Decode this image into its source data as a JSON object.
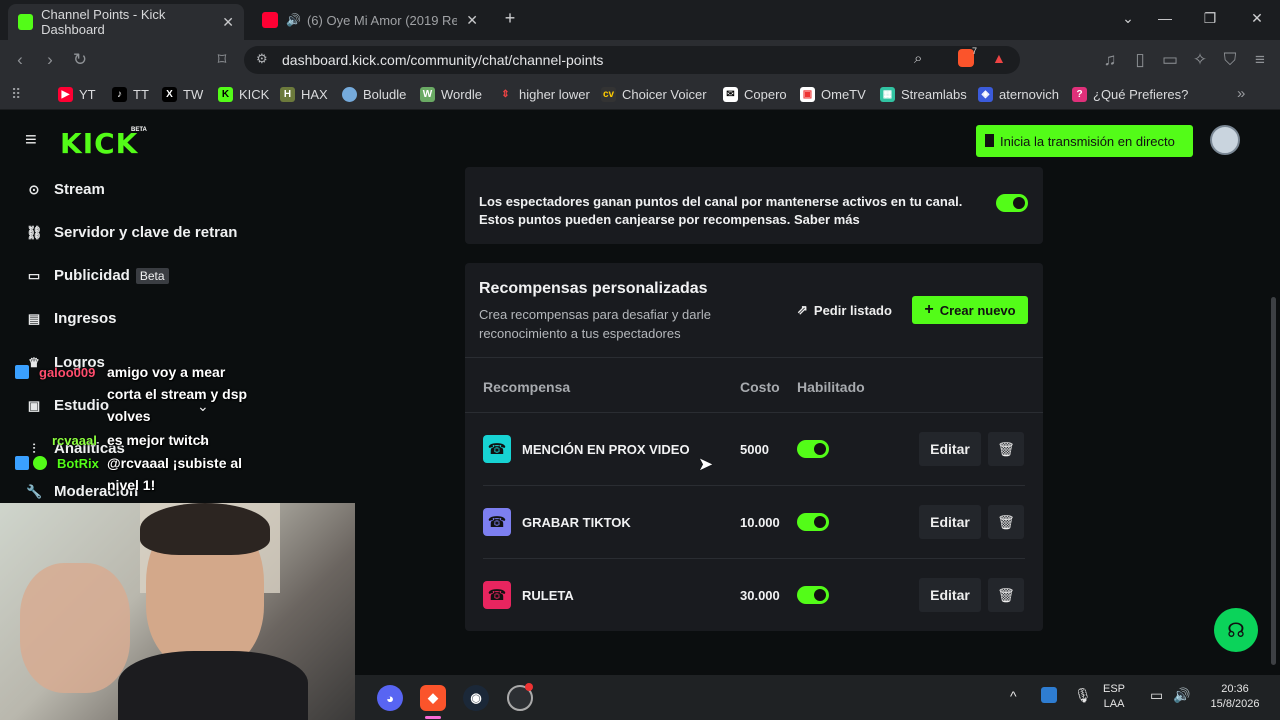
{
  "browser": {
    "tabs": [
      {
        "title": "Channel Points - Kick Dashboard",
        "close": "✕"
      },
      {
        "title": "(6) Oye Mi Amor (2019 Remaster",
        "close": "✕"
      }
    ],
    "new_tab": "+",
    "url": "dashboard.kick.com/community/chat/channel-points",
    "bookmarks": [
      "YT",
      "TT",
      "TW",
      "KICK",
      "HAX",
      "Boludle",
      "Wordle",
      "higher lower",
      "Choicer Voicer",
      "Copero",
      "OmeTV",
      "Streamlabs",
      "aternovich",
      "¿Qué Prefieres?"
    ],
    "shield_count": "7"
  },
  "header": {
    "logo": "KICK",
    "logo_badge": "BETA",
    "go_live": "Inicia la transmisión en directo"
  },
  "sidebar": {
    "items": [
      {
        "label": "Stream",
        "icon": "broadcast-icon"
      },
      {
        "label": "Servidor y clave de retran",
        "icon": "link-icon"
      },
      {
        "label": "Publicidad",
        "badge": "Beta",
        "icon": "ad-icon"
      },
      {
        "label": "Ingresos",
        "icon": "chart-icon"
      },
      {
        "label": "Logros",
        "icon": "trophy-icon"
      },
      {
        "label": "Estudio",
        "icon": "studio-icon"
      },
      {
        "label": "Analíticas",
        "icon": "analytics-icon"
      },
      {
        "label": "Moderación",
        "icon": "wrench-icon"
      }
    ]
  },
  "points_card": {
    "description": "Los espectadores ganan puntos del canal por mantenerse activos en tu canal. Estos puntos pueden canjearse por recompensas. Saber más",
    "enabled": true
  },
  "rewards": {
    "title": "Recompensas personalizadas",
    "subtitle": "Crea recompensas para desafiar y darle reconocimiento a tus espectadores",
    "request_list": "Pedir listado",
    "create_new": "Crear nuevo",
    "columns": [
      "Recompensa",
      "Costo",
      "Habilitado"
    ],
    "edit_label": "Editar",
    "rows": [
      {
        "name": "MENCIÓN EN PROX VIDEO",
        "cost": "5000",
        "color": "#17d3d3",
        "enabled": true
      },
      {
        "name": "GRABAR TIKTOK",
        "cost": "10.000",
        "color": "#7d7ff0",
        "enabled": true
      },
      {
        "name": "RULETA",
        "cost": "30.000",
        "color": "#e8255f",
        "enabled": true
      }
    ]
  },
  "chat_overlay": [
    {
      "user": "galoo009",
      "lines": [
        "amigo voy a mear",
        "corta el stream y dsp",
        "volves"
      ],
      "color": "#ff4d6d"
    },
    {
      "user": "rcvaaal",
      "lines": [
        "es mejor twitch"
      ],
      "color": "#8cff3f"
    },
    {
      "user": "BotRix",
      "lines": [
        "@rcvaaal ¡subiste al",
        "nivel 1!"
      ],
      "color": "#53fc18"
    }
  ],
  "tray": {
    "lang": "ESP",
    "layout": "LAA",
    "time": "20:36",
    "date": "15/8/2026"
  },
  "colors": {
    "accent": "#53fc18",
    "background": "#0b0e0f",
    "card": "#191b1f"
  }
}
